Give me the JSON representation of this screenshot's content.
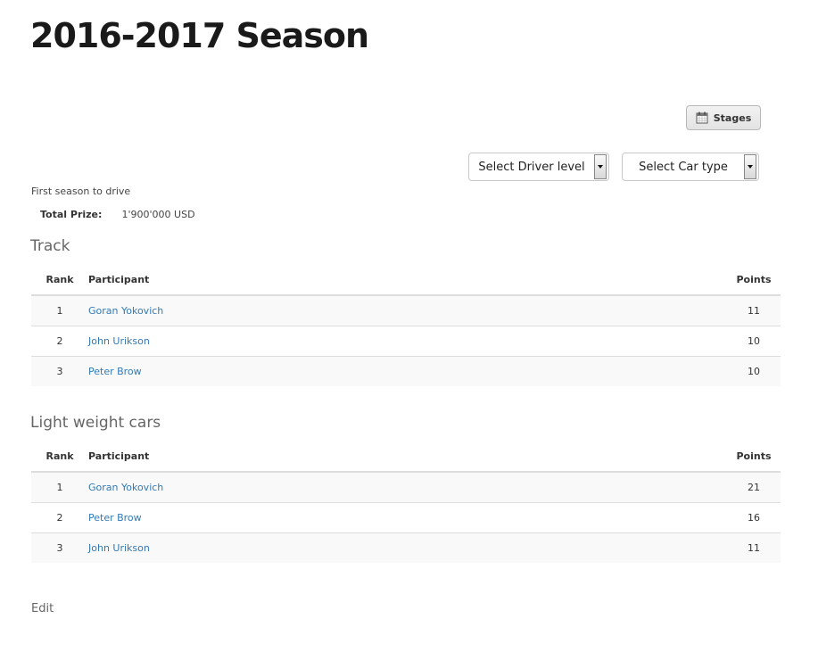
{
  "page": {
    "title": "2016-2017 Season"
  },
  "toolbar": {
    "stages_label": "Stages",
    "stages_icon": "calendar-icon",
    "driver_level_select": {
      "selected": "Select Driver level"
    },
    "car_type_select": {
      "selected": "Select Car type"
    }
  },
  "season": {
    "description": "First season to drive",
    "total_prize_label": "Total Prize:",
    "total_prize_value": "1'900'000 USD"
  },
  "tables": [
    {
      "title": "Track",
      "columns": [
        "Rank",
        "Participant",
        "Points"
      ],
      "rows": [
        {
          "rank": "1",
          "participant": "Goran Yokovich",
          "points": "11"
        },
        {
          "rank": "2",
          "participant": "John Urikson",
          "points": "10"
        },
        {
          "rank": "3",
          "participant": "Peter Brow",
          "points": "10"
        }
      ]
    },
    {
      "title": "Light weight cars",
      "columns": [
        "Rank",
        "Participant",
        "Points"
      ],
      "rows": [
        {
          "rank": "1",
          "participant": "Goran Yokovich",
          "points": "21"
        },
        {
          "rank": "2",
          "participant": "Peter Brow",
          "points": "16"
        },
        {
          "rank": "3",
          "participant": "John Urikson",
          "points": "11"
        }
      ]
    }
  ],
  "footer": {
    "edit_label": "Edit"
  },
  "colors": {
    "link": "#337ab7",
    "row_stripe": "#f9f9f9",
    "border": "#dddddd"
  }
}
